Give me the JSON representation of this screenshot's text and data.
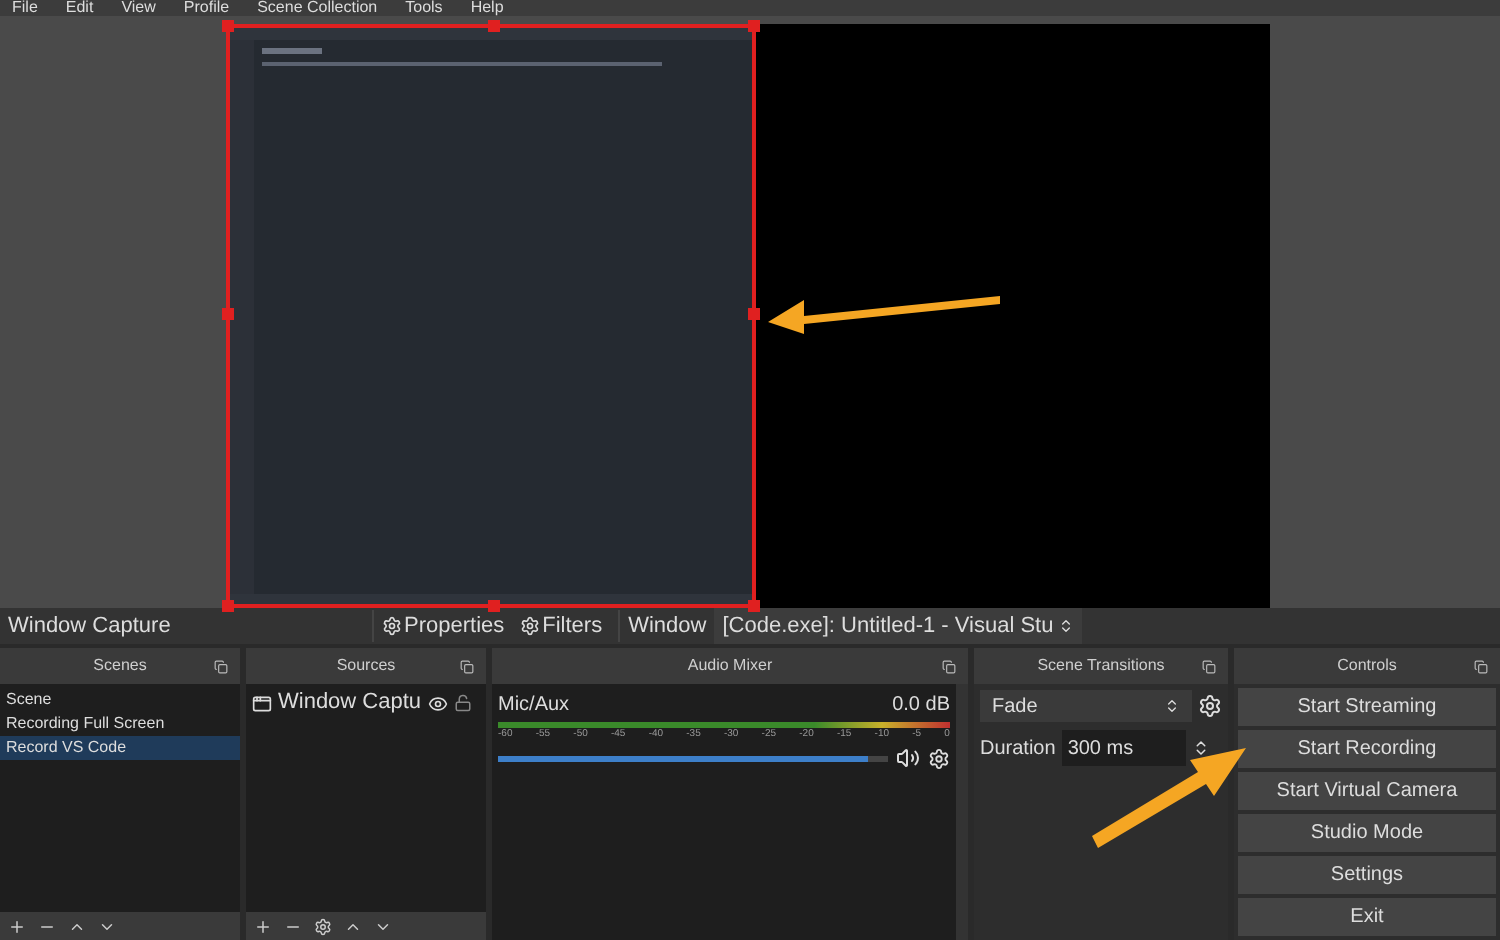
{
  "menu": [
    "File",
    "Edit",
    "View",
    "Profile",
    "Scene Collection",
    "Tools",
    "Help"
  ],
  "source_toolbar": {
    "source_name": "Window Capture",
    "properties": "Properties",
    "filters": "Filters",
    "window_label": "Window",
    "window_value": "[Code.exe]: Untitled-1 - Visual Stu"
  },
  "scenes": {
    "title": "Scenes",
    "items": [
      {
        "label": "Scene",
        "selected": false
      },
      {
        "label": "Recording Full Screen",
        "selected": false
      },
      {
        "label": "Record VS Code",
        "selected": true
      }
    ]
  },
  "sources": {
    "title": "Sources",
    "items": [
      {
        "label": "Window Captu",
        "visible": true,
        "locked": false
      }
    ]
  },
  "audio_mixer": {
    "title": "Audio Mixer",
    "channels": [
      {
        "name": "Mic/Aux",
        "reading": "0.0 dB",
        "level": 0.95,
        "ticks": [
          "-60",
          "-55",
          "-50",
          "-45",
          "-40",
          "-35",
          "-30",
          "-25",
          "-20",
          "-15",
          "-10",
          "-5",
          "0"
        ]
      }
    ]
  },
  "scene_transitions": {
    "title": "Scene Transitions",
    "transition": "Fade",
    "duration_label": "Duration",
    "duration": "300 ms"
  },
  "controls": {
    "title": "Controls",
    "buttons": [
      "Start Streaming",
      "Start Recording",
      "Start Virtual Camera",
      "Studio Mode",
      "Settings",
      "Exit"
    ]
  }
}
